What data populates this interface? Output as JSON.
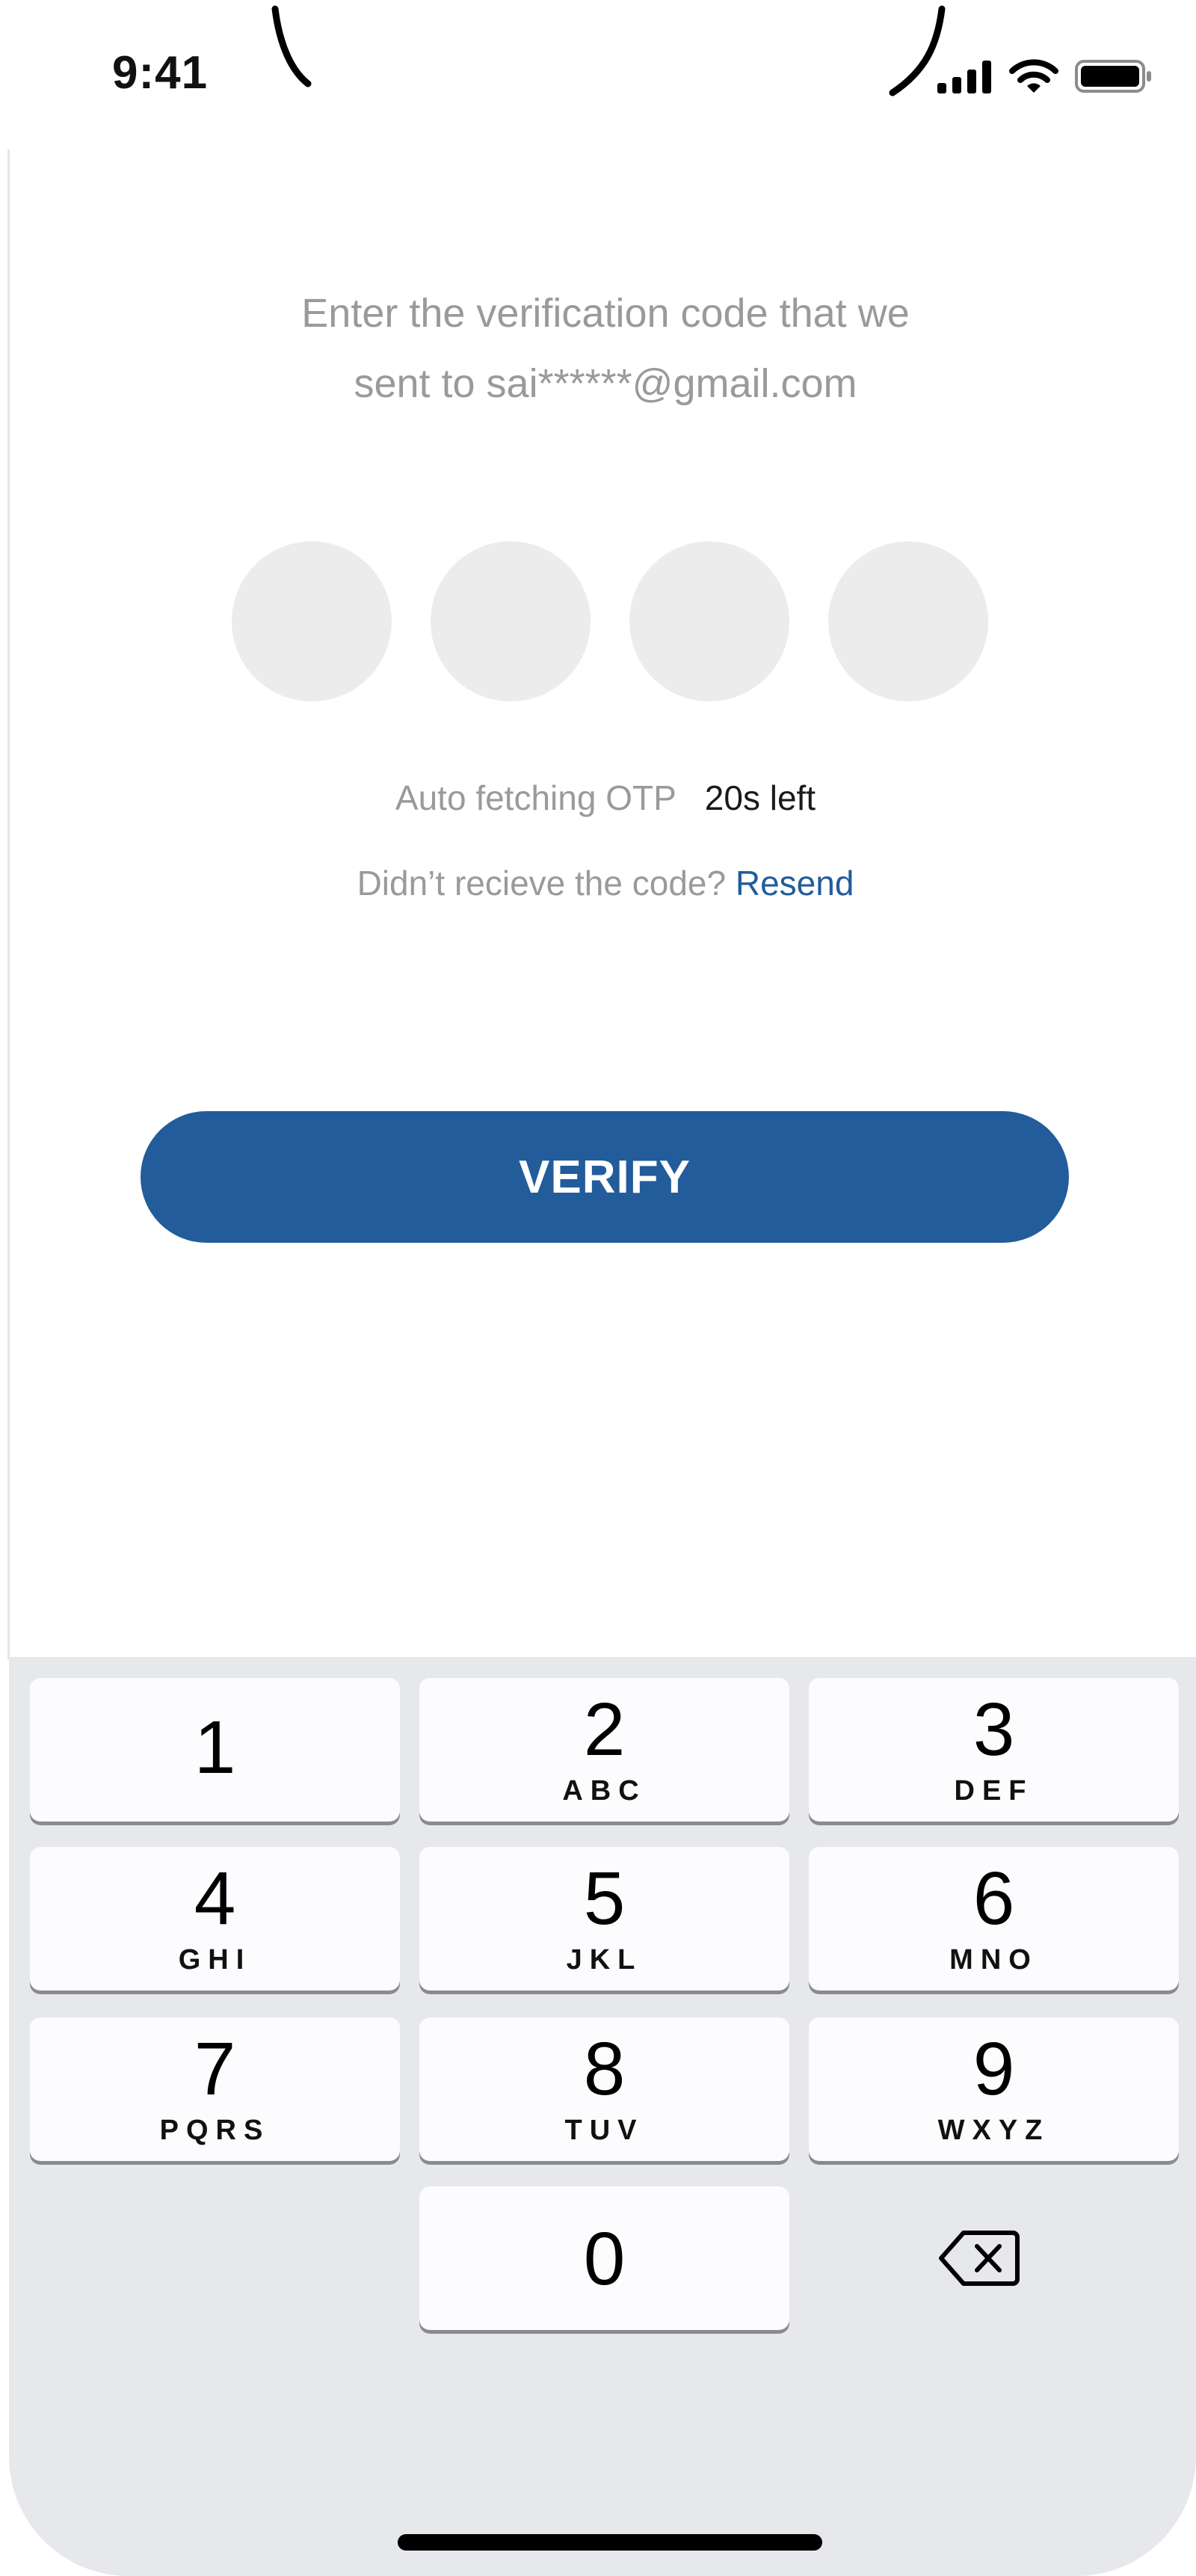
{
  "status_bar": {
    "time": "9:41"
  },
  "instruction": {
    "line1": "Enter the verification code that we",
    "line2": "sent to sai******@gmail.com"
  },
  "otp": {
    "digits": [
      "",
      "",
      "",
      ""
    ]
  },
  "auto_fetch": {
    "label": "Auto fetching OTP",
    "timer": "20s left"
  },
  "resend": {
    "prompt": "Didn’t recieve the code?",
    "link_label": "Resend"
  },
  "verify_button": {
    "label": "VERIFY"
  },
  "keyboard": {
    "keys": [
      {
        "digit": "1",
        "letters": ""
      },
      {
        "digit": "2",
        "letters": "ABC"
      },
      {
        "digit": "3",
        "letters": "DEF"
      },
      {
        "digit": "4",
        "letters": "GHI"
      },
      {
        "digit": "5",
        "letters": "JKL"
      },
      {
        "digit": "6",
        "letters": "MNO"
      },
      {
        "digit": "7",
        "letters": "PQRS"
      },
      {
        "digit": "8",
        "letters": "TUV"
      },
      {
        "digit": "9",
        "letters": "WXYZ"
      },
      {
        "digit": "0",
        "letters": ""
      }
    ],
    "delete_icon": "backspace-icon"
  },
  "colors": {
    "accent": "#225c9a",
    "muted_text": "#9a9a9a",
    "otp_box": "#ececec",
    "keyboard_bg": "#e7e8eb"
  }
}
